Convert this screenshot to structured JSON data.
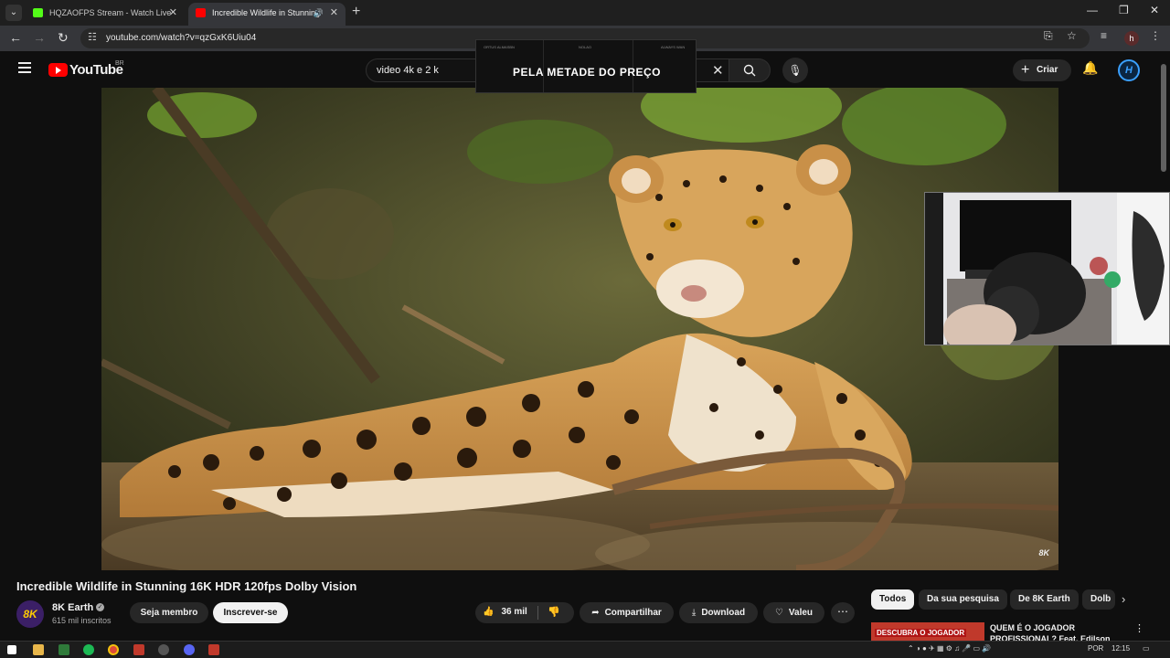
{
  "browser": {
    "tabs": [
      {
        "title": "HQZAOFPS Stream - Watch Live",
        "favicon_color": "#53fc18"
      },
      {
        "title": "Incredible Wildlife in Stunning",
        "favicon_color": "#ff0000"
      }
    ],
    "url": "youtube.com/watch?v=qzGxK6Uiu04",
    "profile_initial": "h"
  },
  "youtube": {
    "logo_text": "YouTube",
    "region": "BR",
    "search_query": "video 4k e 2 k",
    "create_label": "Criar",
    "account_initial": "H"
  },
  "overlay_ad": {
    "headline": "PELA METADE DO PREÇO",
    "small_texts": [
      "ORTUS ALMASBN",
      "NOLAO",
      "ALWAYS WAN"
    ]
  },
  "video": {
    "watermark": "8K",
    "title": "Incredible Wildlife in Stunning 16K HDR 120fps Dolby Vision",
    "channel": {
      "name": "8K Earth",
      "avatar_text": "8K",
      "subscribers": "615 mil inscritos"
    },
    "join_label": "Seja membro",
    "subscribe_label": "Inscrever-se",
    "likes": "36 mil",
    "share_label": "Compartilhar",
    "download_label": "Download",
    "thanks_label": "Valeu",
    "more_label": "⋯"
  },
  "sidebar": {
    "chips": [
      "Todos",
      "Da sua pesquisa",
      "De 8K Earth",
      "Dolb"
    ],
    "recommendation": {
      "thumb_text": "DESCUBRA O JOGADOR",
      "title": "QUEM É O JOGADOR PROFISSIONAL? Feat. Edilson"
    }
  },
  "taskbar": {
    "language": "POR",
    "time": "12:15"
  }
}
